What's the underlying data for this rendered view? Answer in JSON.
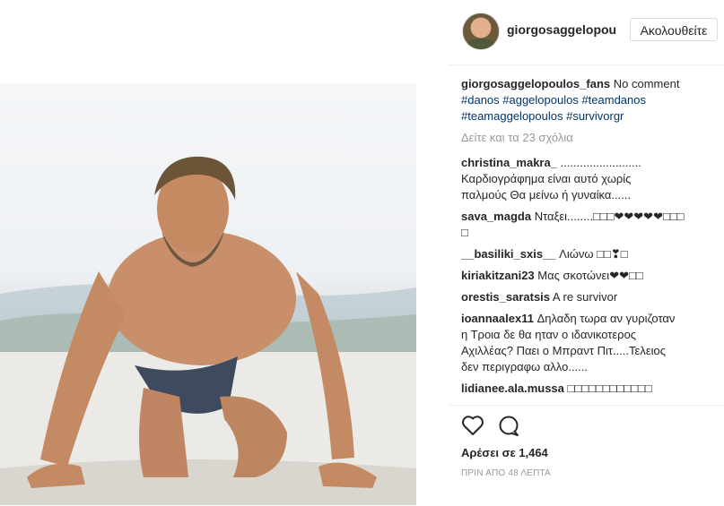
{
  "post": {
    "username": "giorgosaggelopou",
    "follow_label": "Ακολουθείτε",
    "caption": {
      "author": "giorgosaggelopoulos_fans",
      "text": "No comment",
      "hashtags_line1": "#danos #aggelopoulos #teamdanos",
      "hashtags_line2": "#teamaggelopoulos #survivorgr"
    },
    "view_all": "Δείτε και τα 23 σχόλια",
    "comments": [
      {
        "author": "christina_makra_",
        "text": ".........................\nΚαρδιογράφημα είναι αυτό χωρίς\nπαλμούς Θα μείνω ή γυναίκα......"
      },
      {
        "author": "sava_magda",
        "text": "Νταξει........□□□❤❤❤❤❤□□□\n□"
      },
      {
        "author": "__basiliki_sxis__",
        "text": "Λιώνω □□❣□"
      },
      {
        "author": "kiriakitzani23",
        "text": "Μας σκοτώνει❤❤□□"
      },
      {
        "author": "orestis_saratsis",
        "text": "A re survivor"
      },
      {
        "author": "ioannaalex11",
        "text": "Δηλαδη τωρα αν γυριζοταν\nη Τροια δε θα ηταν ο ιδανικοτερος\nΑχιλλέας? Παει ο Μπραντ Πιτ.....Τελειος\nδεν περιγραφω αλλο......"
      },
      {
        "author": "lidianee.ala.mussa",
        "text": "□□□□□□□□□□□□"
      }
    ],
    "likes": "Αρέσει σε 1,464",
    "timestamp": "ΠΡΙΝ ΑΠΟ 48 ΛΕΠΤΑ",
    "icons": {
      "like": "heart-icon",
      "comment": "comment-icon"
    }
  }
}
